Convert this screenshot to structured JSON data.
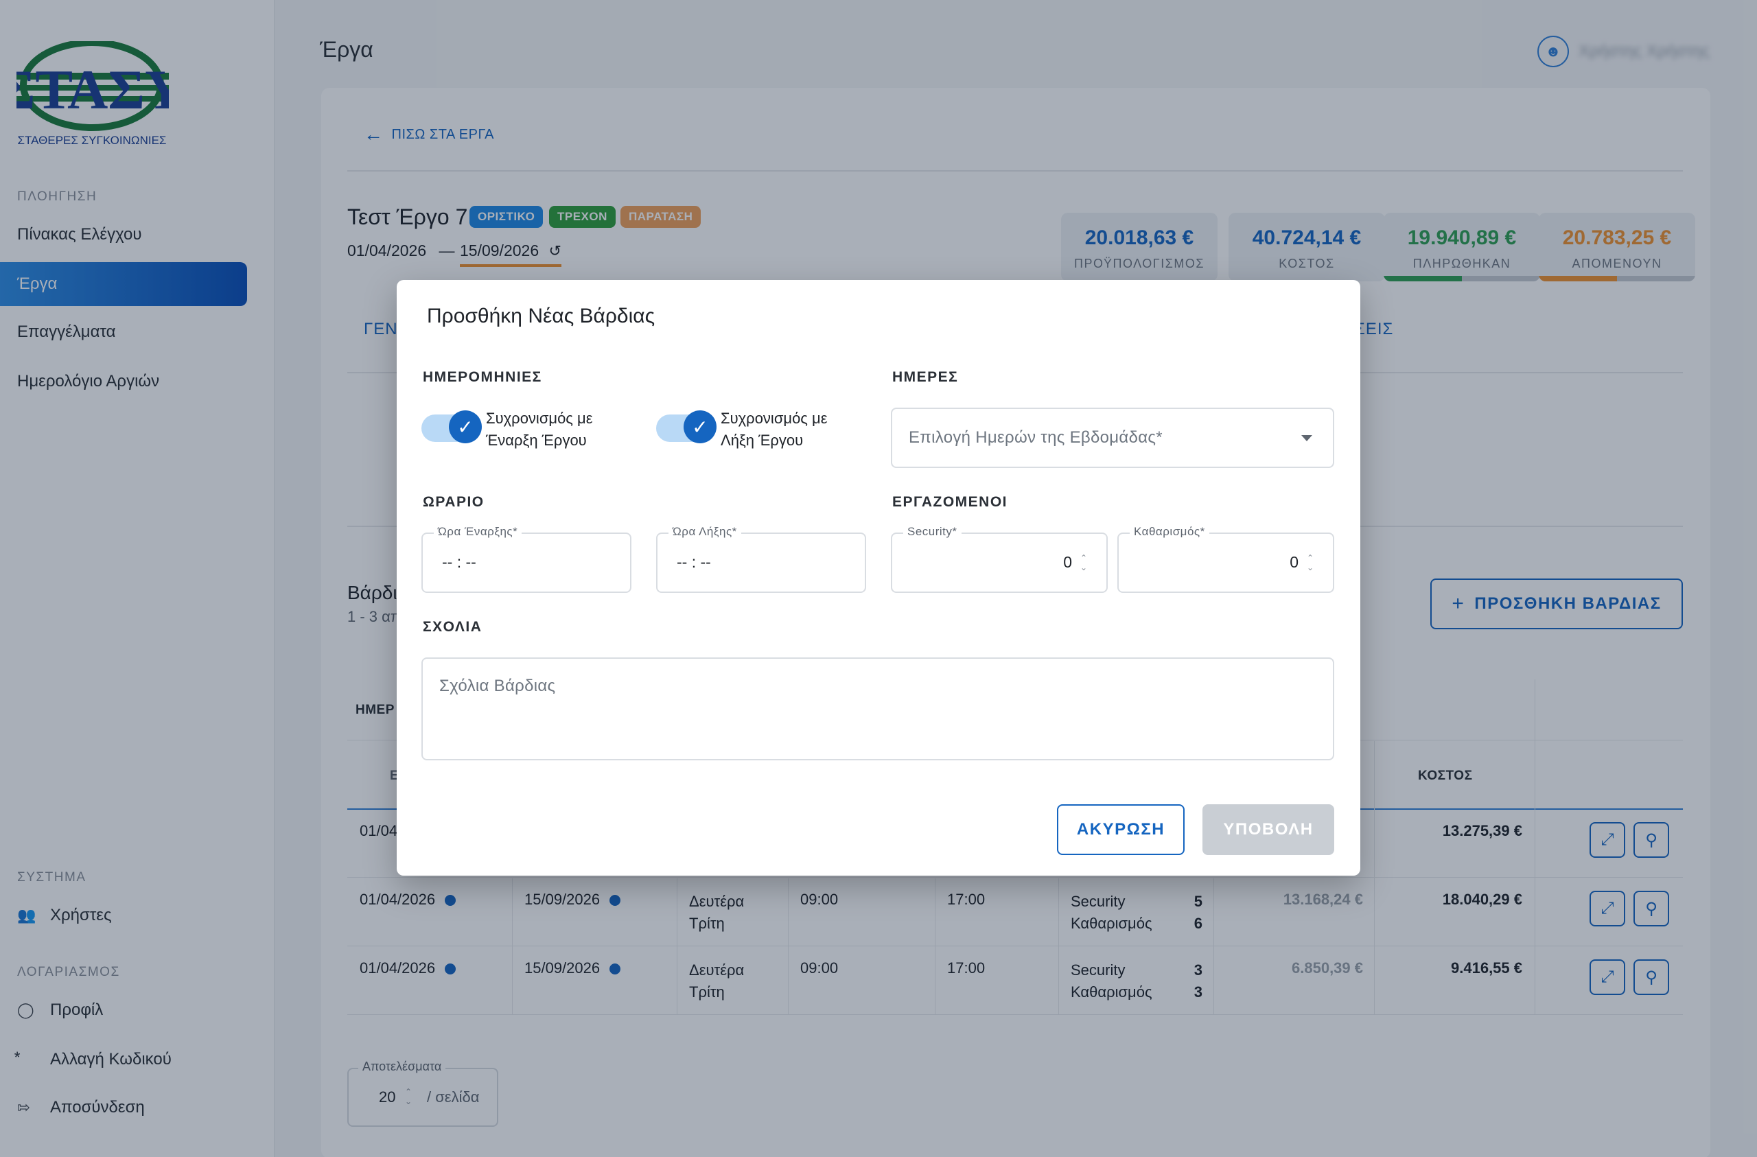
{
  "brand": {
    "logo_text": "ΣΤΑΣΥ",
    "logo_subtitle": "ΣΤΑΘΕΡΕΣ ΣΥΓΚΟΙΝΩΝΙΕΣ",
    "green": "#1a7a3a",
    "blue": "#1c3f94"
  },
  "sidebar": {
    "nav_heading": "ΠΛΟΗΓΗΣΗ",
    "items": [
      {
        "label": "Πίνακας Ελέγχου"
      },
      {
        "label": "Έργα"
      },
      {
        "label": "Επαγγέλματα"
      },
      {
        "label": "Ημερολόγιο Αργιών"
      }
    ],
    "system_heading": "ΣΥΣΤΗΜΑ",
    "system_items": [
      {
        "label": "Χρήστες",
        "icon": "users-icon"
      }
    ],
    "account_heading": "ΛΟΓΑΡΙΑΣΜΟΣ",
    "account_items": [
      {
        "label": "Προφίλ",
        "icon": "profile-icon"
      },
      {
        "label": "Αλλαγή Κωδικού",
        "icon": "password-icon"
      },
      {
        "label": "Αποσύνδεση",
        "icon": "logout-icon"
      }
    ]
  },
  "header": {
    "title": "Έργα",
    "user_name": "Χρήστης Χρήστης"
  },
  "project": {
    "back_label": "ΠΙΣΩ ΣΤΑ ΕΡΓΑ",
    "title": "Τεστ Έργο 7",
    "chips": [
      "ΟΡΙΣΤΙΚΟ",
      "ΤΡΕΧΟΝ",
      "ΠΑΡΑΤΑΣΗ"
    ],
    "start_date": "01/04/2026",
    "date_sep": "—",
    "end_date": "15/09/2026",
    "kpis": [
      {
        "value": "20.018,63 €",
        "label": "ΠΡΟΫΠΟΛΟΓΙΣΜΟΣ",
        "color": "#1565c0"
      },
      {
        "value": "40.724,14 €",
        "label": "ΚΟΣΤΟΣ",
        "color": "#1565c0"
      },
      {
        "value": "19.940,89 €",
        "label": "ΠΛΗΡΩΘΗΚΑΝ",
        "color": "#2e9e52",
        "fill": 0.5
      },
      {
        "value": "20.783,25 €",
        "label": "ΑΠΟΜΕΝΟΥΝ",
        "color": "#f0922f",
        "fill": 0.5
      }
    ],
    "tab_left": "ΓΕΝ",
    "tab_right": "ΣΕΙΣ"
  },
  "shifts": {
    "title": "Βάρδι",
    "subtitle": "1 - 3 απ",
    "add_button": "ΠΡΟΣΘΗΚΗ ΒΑΡΔΙΑΣ",
    "group_header": "ΗΜΕΡ",
    "col_first": "Ε",
    "col_cost": "ΚΟΣΤΟΣ",
    "rows": [
      {
        "start": "01/04/",
        "end": "",
        "days1": "",
        "days2": "",
        "from": "",
        "to": "",
        "w1": "",
        "n1": "",
        "w2": "",
        "n2": "",
        "budget": "",
        "cost": "13.275,39 €"
      },
      {
        "start": "01/04/2026",
        "end": "15/09/2026",
        "days1": "Δευτέρα",
        "days2": "Τρίτη",
        "from": "09:00",
        "to": "17:00",
        "w1": "Security",
        "n1": "5",
        "w2": "Καθαρισμός",
        "n2": "6",
        "budget": "13.168,24 €",
        "cost": "18.040,29 €"
      },
      {
        "start": "01/04/2026",
        "end": "15/09/2026",
        "days1": "Δευτέρα",
        "days2": "Τρίτη",
        "from": "09:00",
        "to": "17:00",
        "w1": "Security",
        "n1": "3",
        "w2": "Καθαρισμός",
        "n2": "3",
        "budget": "6.850,39 €",
        "cost": "9.416,55 €"
      }
    ],
    "pager_label": "Αποτελέσματα",
    "pager_value": "20",
    "pager_unit": "/ σελίδα"
  },
  "modal": {
    "title": "Προσθήκη Νέας Βάρδιας",
    "dates_heading": "ΗΜΕΡΟΜΗΝΙΕΣ",
    "sync_start_1": "Συχρονισμός με",
    "sync_start_2": "Έναρξη Έργου",
    "sync_end_1": "Συχρονισμός με",
    "sync_end_2": "Λήξη Έργου",
    "days_heading": "ΗΜΕΡΕΣ",
    "days_placeholder": "Επιλογή Ημερών της Εβδομάδας*",
    "schedule_heading": "ΩΡΑΡΙΟ",
    "start_time_label": "Ώρα Έναρξης*",
    "start_time_value": "-- : --",
    "end_time_label": "Ώρα Λήξης*",
    "end_time_value": "-- : --",
    "workers_heading": "ΕΡΓΑΖΟΜΕΝΟΙ",
    "security_label": "Security*",
    "security_value": "0",
    "cleaning_label": "Καθαρισμός*",
    "cleaning_value": "0",
    "comments_heading": "ΣΧΟΛΙΑ",
    "comments_placeholder": "Σχόλια Βάρδιας",
    "cancel_label": "ΑΚΥΡΩΣΗ",
    "submit_label": "ΥΠΟΒΟΛΗ"
  }
}
